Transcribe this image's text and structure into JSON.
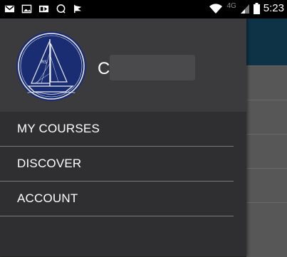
{
  "status_bar": {
    "time": "5:23",
    "network_label": "4G",
    "icons": [
      "gmail-icon",
      "image-icon",
      "media-icon",
      "chat-icon",
      "flag-icon",
      "wifi-icon",
      "signal-icon",
      "battery-icon"
    ]
  },
  "drawer": {
    "user": {
      "name_visible": "C"
    },
    "menu_items": [
      {
        "label": "MY COURSES"
      },
      {
        "label": "DISCOVER"
      },
      {
        "label": "ACCOUNT"
      }
    ]
  },
  "colors": {
    "drawer_bg": "#2f2f31",
    "drawer_header_bg": "#3b3b3e",
    "app_header": "#0e3246",
    "avatar_bg": "#1a2b6b"
  }
}
